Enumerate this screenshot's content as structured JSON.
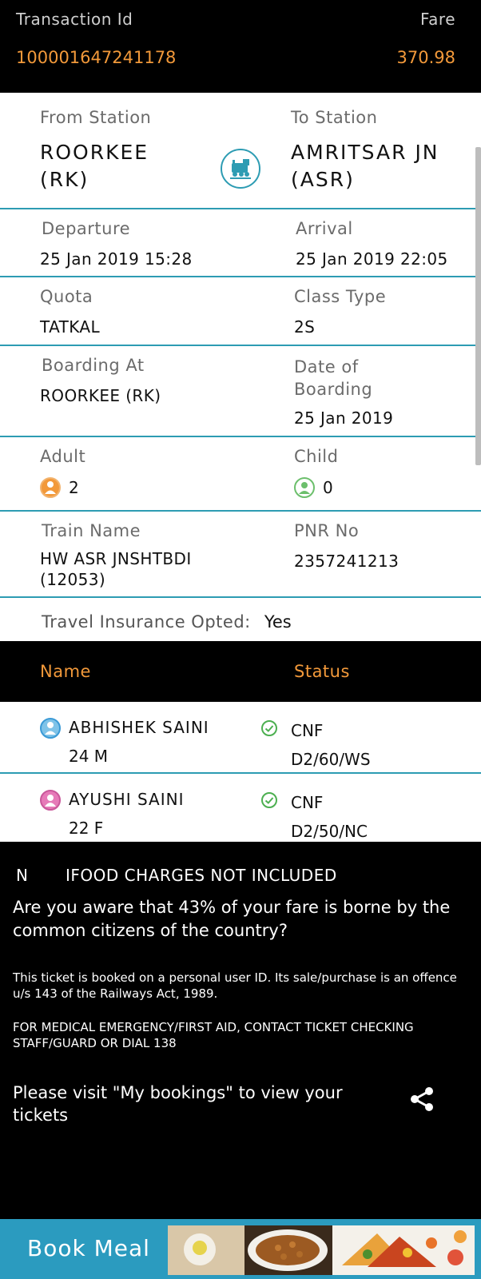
{
  "header": {
    "transaction_label": "Transaction Id",
    "fare_label": "Fare",
    "transaction_id": "100001647241178",
    "fare": "370.98"
  },
  "journey": {
    "from_label": "From Station",
    "from_value": "ROORKEE (RK)",
    "to_label": "To Station",
    "to_value": "AMRITSAR JN (ASR)",
    "departure_label": "Departure",
    "departure_value": "25 Jan 2019 15:28",
    "arrival_label": "Arrival",
    "arrival_value": "25 Jan 2019 22:05",
    "quota_label": "Quota",
    "quota_value": "TATKAL",
    "class_label": "Class Type",
    "class_value": "2S",
    "boarding_label": "Boarding At",
    "boarding_value": "ROORKEE (RK)",
    "date_label": "Date of Boarding",
    "date_value": "25 Jan 2019",
    "adult_label": "Adult",
    "adult_value": "2",
    "child_label": "Child",
    "child_value": "0",
    "train_label": "Train Name",
    "train_value": "HW ASR JNSHTBDI (12053)",
    "pnr_label": "PNR No",
    "pnr_value": "2357241213",
    "insurance_label": "Travel Insurance Opted:",
    "insurance_value": "Yes"
  },
  "passengers": {
    "name_header": "Name",
    "status_header": "Status",
    "list": [
      {
        "name": "ABHISHEK SAINI",
        "age": "24 M",
        "status": "CNF",
        "berth": "D2/60/WS",
        "icon": "male-passenger-icon"
      },
      {
        "name": "AYUSHI SAINI",
        "age": "22 F",
        "status": "CNF",
        "berth": "D2/50/NC",
        "icon": "female-passenger-icon"
      }
    ]
  },
  "info": {
    "food_prefix": "N",
    "food_note": "IFOOD CHARGES NOT INCLUDED",
    "question": "Are you aware that 43% of your fare is borne by the common citizens of the country?",
    "legal": "This ticket is booked on a personal user ID. Its sale/purchase is an offence u/s 143 of the Railways Act, 1989.",
    "medical": "FOR MEDICAL EMERGENCY/FIRST AID, CONTACT TICKET CHECKING STAFF/GUARD OR DIAL 138",
    "visit": "Please visit \"My bookings\" to view your tickets"
  },
  "book_meal": {
    "label": "Book Meal"
  },
  "colors": {
    "accent": "#2d9cb3",
    "orange": "#f2993a",
    "banner": "#2b9bbf"
  }
}
